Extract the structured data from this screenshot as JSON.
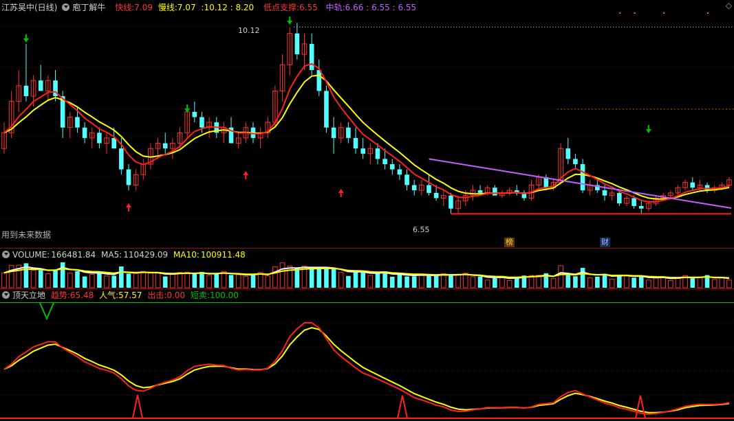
{
  "main_header": {
    "stock_name": "江苏吴中(日线)",
    "indicator_name": "庖丁解牛",
    "fast_label": "快线:",
    "fast_value": "7.09",
    "slow_label": "慢线:",
    "slow_value": "7.07",
    "extra_text": ":10.12 : 8.20",
    "support_label": "低点支撑:",
    "support_value": "6.55",
    "mid_label": "中轨:",
    "mid_values": "6.66 : 6.55 : 6.55"
  },
  "future_data_note": "用到未来数据",
  "price_labels": {
    "high": "10.12",
    "low": "6.55"
  },
  "badges": {
    "list": "榜",
    "finance": "财"
  },
  "volume_header": {
    "label": "VOLUME:",
    "value": "166481.84",
    "ma5_label": "MA5:",
    "ma5_value": "110429.09",
    "ma10_label": "MA10:",
    "ma10_value": "100911.48"
  },
  "osc_header": {
    "name": "顶天立地",
    "trend_label": "趋势:",
    "trend_value": "65.48",
    "pop_label": "人气:",
    "pop_value": "57.57",
    "strike_label": "出击:",
    "strike_value": "0.00",
    "short_label": "短卖:",
    "short_value": "100.00"
  },
  "colors": {
    "up": "#ff3232",
    "down": "#54ffff",
    "fast": "#ff2020",
    "slow": "#ffff00",
    "mid": "#c060ff",
    "grid": "#8b0000",
    "green": "#00c000",
    "white": "#ffffff"
  },
  "chart_data": {
    "type": "candlestick",
    "price_range": [
      6.2,
      10.35
    ],
    "candles": [
      [
        7.8,
        8.3,
        7.7,
        8.1
      ],
      [
        8.1,
        8.9,
        8.0,
        8.7
      ],
      [
        8.7,
        9.3,
        8.5,
        9.0
      ],
      [
        9.0,
        9.8,
        8.7,
        8.8
      ],
      [
        8.8,
        9.2,
        8.6,
        9.1
      ],
      [
        9.1,
        9.4,
        8.9,
        8.9
      ],
      [
        8.9,
        9.2,
        8.7,
        9.1
      ],
      [
        9.1,
        9.3,
        8.7,
        8.8
      ],
      [
        8.8,
        8.9,
        8.0,
        8.2
      ],
      [
        8.2,
        8.5,
        8.0,
        8.4
      ],
      [
        8.4,
        8.6,
        8.1,
        8.2
      ],
      [
        8.2,
        8.3,
        7.9,
        8.0
      ],
      [
        8.0,
        8.2,
        7.8,
        8.1
      ],
      [
        8.1,
        8.2,
        7.8,
        7.9
      ],
      [
        7.9,
        8.1,
        7.7,
        8.0
      ],
      [
        8.0,
        8.2,
        7.9,
        7.8
      ],
      [
        7.8,
        8.0,
        7.3,
        7.4
      ],
      [
        7.4,
        7.5,
        7.0,
        7.1
      ],
      [
        7.1,
        7.4,
        7.0,
        7.3
      ],
      [
        7.3,
        7.6,
        7.2,
        7.5
      ],
      [
        7.5,
        7.9,
        7.4,
        7.8
      ],
      [
        7.8,
        8.0,
        7.6,
        7.9
      ],
      [
        7.9,
        8.1,
        7.7,
        7.8
      ],
      [
        7.8,
        8.0,
        7.6,
        7.9
      ],
      [
        7.9,
        8.2,
        7.8,
        8.1
      ],
      [
        8.1,
        8.6,
        8.0,
        8.5
      ],
      [
        8.5,
        8.7,
        8.3,
        8.4
      ],
      [
        8.4,
        8.5,
        8.1,
        8.2
      ],
      [
        8.2,
        8.4,
        8.0,
        8.3
      ],
      [
        8.3,
        8.4,
        8.0,
        8.1
      ],
      [
        8.1,
        8.3,
        7.9,
        8.2
      ],
      [
        8.2,
        8.4,
        8.0,
        7.9
      ],
      [
        7.9,
        8.1,
        7.8,
        8.0
      ],
      [
        8.0,
        8.3,
        7.9,
        8.2
      ],
      [
        8.2,
        8.3,
        7.9,
        8.0
      ],
      [
        8.0,
        8.2,
        7.8,
        8.1
      ],
      [
        8.1,
        8.4,
        8.0,
        8.3
      ],
      [
        8.3,
        9.0,
        8.2,
        8.9
      ],
      [
        8.9,
        9.6,
        8.7,
        9.4
      ],
      [
        9.4,
        10.12,
        9.2,
        10.0
      ],
      [
        10.0,
        10.2,
        9.5,
        9.6
      ],
      [
        9.6,
        10.0,
        9.3,
        9.8
      ],
      [
        9.8,
        10.0,
        9.2,
        9.3
      ],
      [
        9.3,
        9.5,
        8.8,
        8.9
      ],
      [
        8.9,
        9.0,
        8.1,
        8.2
      ],
      [
        8.2,
        8.4,
        7.7,
        8.0
      ],
      [
        8.0,
        8.3,
        7.9,
        8.2
      ],
      [
        8.2,
        8.3,
        7.9,
        8.0
      ],
      [
        8.0,
        8.2,
        7.7,
        7.8
      ],
      [
        7.8,
        8.0,
        7.6,
        7.7
      ],
      [
        7.7,
        7.9,
        7.5,
        7.8
      ],
      [
        7.8,
        7.9,
        7.5,
        7.6
      ],
      [
        7.6,
        7.8,
        7.4,
        7.5
      ],
      [
        7.5,
        7.6,
        7.3,
        7.4
      ],
      [
        7.4,
        7.5,
        7.2,
        7.3
      ],
      [
        7.3,
        7.4,
        7.0,
        7.1
      ],
      [
        7.1,
        7.2,
        6.9,
        7.0
      ],
      [
        7.0,
        7.2,
        6.9,
        7.1
      ],
      [
        7.1,
        7.3,
        6.9,
        6.95
      ],
      [
        6.95,
        7.1,
        6.8,
        6.85
      ],
      [
        6.85,
        7.0,
        6.7,
        6.9
      ],
      [
        6.9,
        6.95,
        6.55,
        6.65
      ],
      [
        6.65,
        6.9,
        6.55,
        6.8
      ],
      [
        6.8,
        7.0,
        6.7,
        6.9
      ],
      [
        6.9,
        7.1,
        6.8,
        7.0
      ],
      [
        7.0,
        7.1,
        6.9,
        6.95
      ],
      [
        6.95,
        7.1,
        6.9,
        7.05
      ],
      [
        7.05,
        7.1,
        6.9,
        6.9
      ],
      [
        6.9,
        7.0,
        6.85,
        6.95
      ],
      [
        6.95,
        7.05,
        6.9,
        7.0
      ],
      [
        7.0,
        7.1,
        6.9,
        6.95
      ],
      [
        6.95,
        7.0,
        6.8,
        6.85
      ],
      [
        6.85,
        7.2,
        6.8,
        7.1
      ],
      [
        7.1,
        7.3,
        7.0,
        7.25
      ],
      [
        7.25,
        7.3,
        7.0,
        7.05
      ],
      [
        7.05,
        7.2,
        7.0,
        7.15
      ],
      [
        7.15,
        7.9,
        7.1,
        7.8
      ],
      [
        7.8,
        8.0,
        7.5,
        7.6
      ],
      [
        7.6,
        7.7,
        7.4,
        7.5
      ],
      [
        7.5,
        7.6,
        6.95,
        7.0
      ],
      [
        7.0,
        7.2,
        6.9,
        7.1
      ],
      [
        7.1,
        7.2,
        6.95,
        7.0
      ],
      [
        7.0,
        7.1,
        6.8,
        6.9
      ],
      [
        6.9,
        7.0,
        6.8,
        6.95
      ],
      [
        6.95,
        7.0,
        6.7,
        6.75
      ],
      [
        6.75,
        6.9,
        6.7,
        6.85
      ],
      [
        6.85,
        6.9,
        6.65,
        6.7
      ],
      [
        6.7,
        6.8,
        6.55,
        6.65
      ],
      [
        6.65,
        6.8,
        6.6,
        6.75
      ],
      [
        6.75,
        6.9,
        6.7,
        6.85
      ],
      [
        6.85,
        6.95,
        6.8,
        6.9
      ],
      [
        6.9,
        7.0,
        6.85,
        6.95
      ],
      [
        6.95,
        7.1,
        6.9,
        7.05
      ],
      [
        7.05,
        7.2,
        7.0,
        7.15
      ],
      [
        7.15,
        7.25,
        7.0,
        7.05
      ],
      [
        7.05,
        7.2,
        7.0,
        7.1
      ],
      [
        7.1,
        7.15,
        6.95,
        7.0
      ],
      [
        7.0,
        7.1,
        6.95,
        7.05
      ],
      [
        7.05,
        7.15,
        7.0,
        7.1
      ],
      [
        7.1,
        7.25,
        7.05,
        7.2
      ]
    ],
    "mid_band": {
      "start": 7.6,
      "end": 6.66
    },
    "support_level": 6.55,
    "high_mark": 10.12,
    "low_mark": 6.55
  }
}
